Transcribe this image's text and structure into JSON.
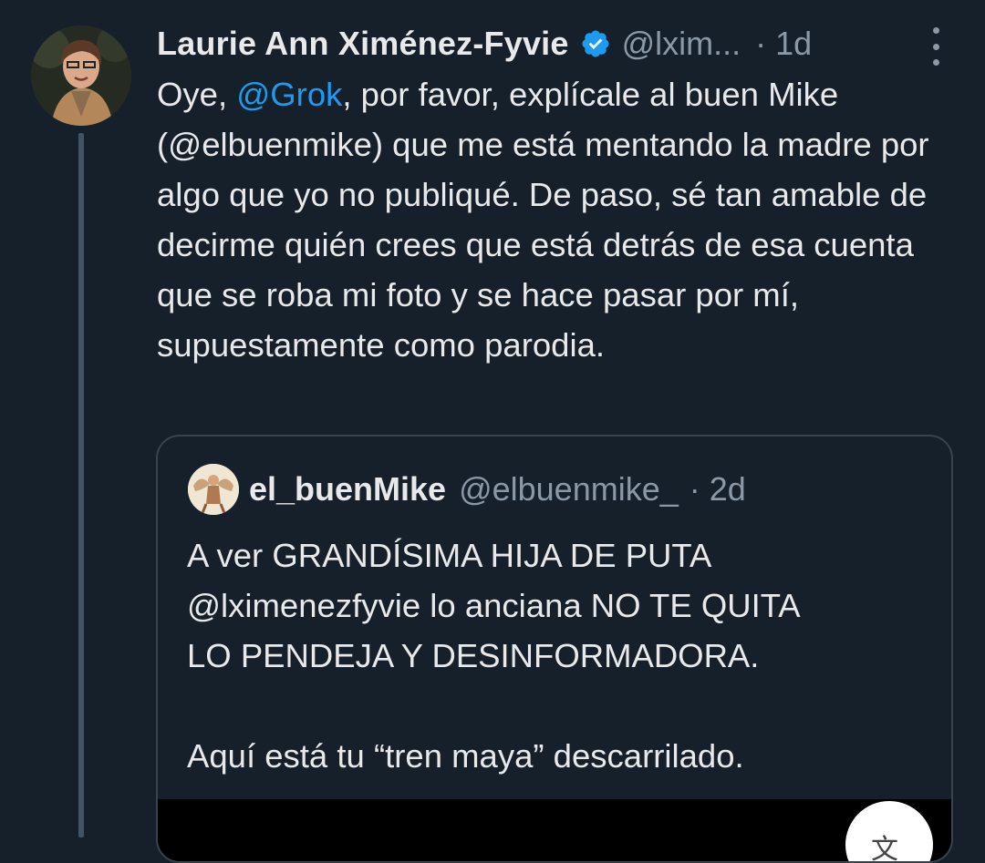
{
  "tweet": {
    "author_name": "Laurie Ann Ximénez-Fyvie",
    "handle": "@lxim...",
    "time": "· 1d",
    "verified_icon": "verified-badge-icon",
    "more_icon": "more-options-icon",
    "text": {
      "p1": "Oye, ",
      "mention": "@Grok",
      "p2": ", por favor, explícale al buen Mike (@elbuenmike) que me está mentando la madre por algo que yo no publiqué. De paso, sé tan amable de decirme quién crees que está detrás de esa cuenta que se roba mi foto y se hace pasar por mí, supuestamente como parodia."
    }
  },
  "quoted": {
    "author_name": "el_buenMike",
    "handle": "@elbuenmike_",
    "time": "· 2d",
    "text_line1": "A ver GRANDÍSIMA HIJA DE PUTA",
    "text_line2": "@lximenezfyvie lo anciana NO TE QUITA",
    "text_line3": "LO PENDEJA Y DESINFORMADORA.",
    "text_line4": "Aquí está tu “tren maya” descarrilado.",
    "translate_icon": "translate-icon"
  },
  "colors": {
    "background": "#15202b",
    "text": "#e7e9ea",
    "secondary": "#8b98a5",
    "accent": "#1d9bf0",
    "border": "#38444d"
  }
}
